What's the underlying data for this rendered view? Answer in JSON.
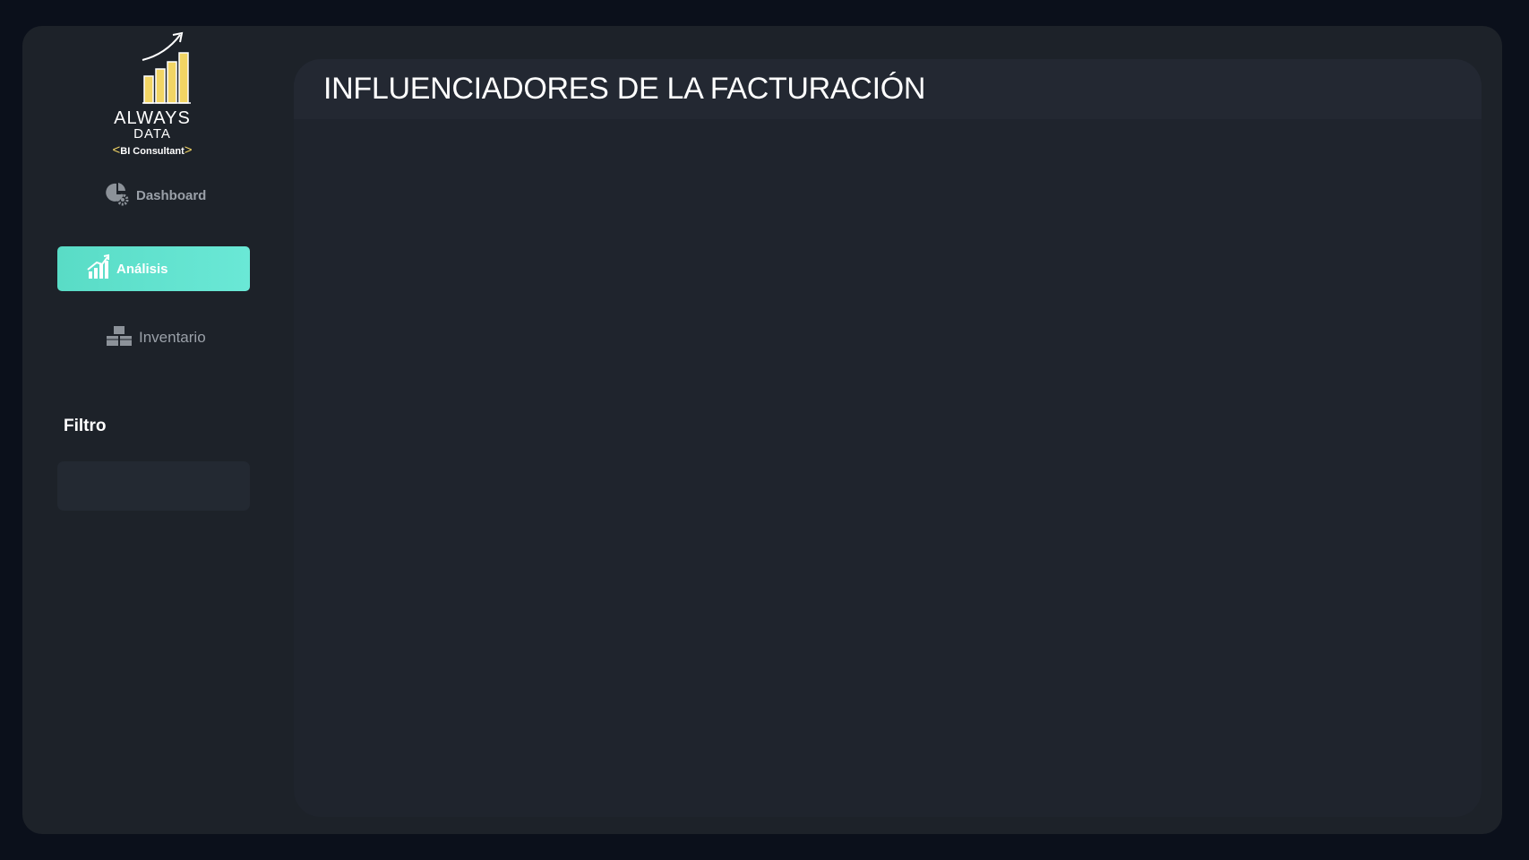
{
  "logo": {
    "line1": "ALWAYS",
    "line2": "DATA",
    "line3": "BI Consultant",
    "bracket_left": "<",
    "bracket_right": ">",
    "accent_color": "#f2d564"
  },
  "nav": {
    "items": [
      {
        "label": "Dashboard",
        "icon": "pie-chart-gear-icon",
        "active": false
      },
      {
        "label": "Análisis",
        "icon": "bar-chart-up-icon",
        "active": true
      },
      {
        "label": "Inventario",
        "icon": "boxes-icon",
        "active": false
      }
    ],
    "active_color": "#5fe0cb"
  },
  "filter": {
    "title": "Filtro"
  },
  "main": {
    "title": "INFLUENCIADORES DE LA FACTURACIÓN"
  }
}
